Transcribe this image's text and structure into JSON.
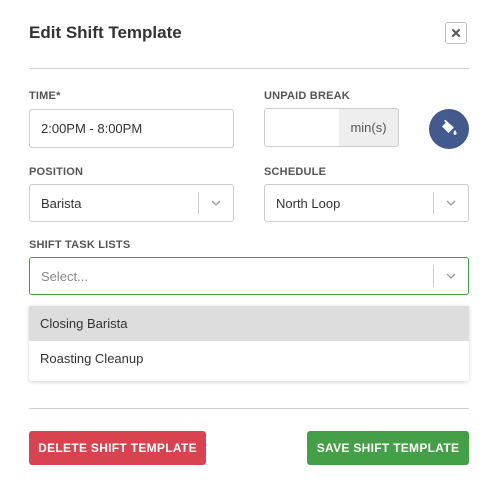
{
  "modal": {
    "title": "Edit Shift Template",
    "close_icon": "close-icon"
  },
  "time": {
    "label": "TIME*",
    "value": "2:00PM - 8:00PM"
  },
  "unpaid_break": {
    "label": "UNPAID BREAK",
    "value": "",
    "unit": "min(s)"
  },
  "color_picker": {
    "icon": "paint-bucket-icon",
    "color": "#435a8c"
  },
  "position": {
    "label": "POSITION",
    "value": "Barista"
  },
  "schedule": {
    "label": "SCHEDULE",
    "value": "North Loop"
  },
  "shift_task_lists": {
    "label": "SHIFT TASK LISTS",
    "placeholder": "Select...",
    "options": [
      "Closing Barista",
      "Roasting Cleanup"
    ]
  },
  "actions": {
    "delete_label": "DELETE SHIFT TEMPLATE",
    "save_label": "SAVE SHIFT TEMPLATE"
  },
  "colors": {
    "danger": "#d9434f",
    "success": "#43a047",
    "focus_border": "#43a047"
  }
}
